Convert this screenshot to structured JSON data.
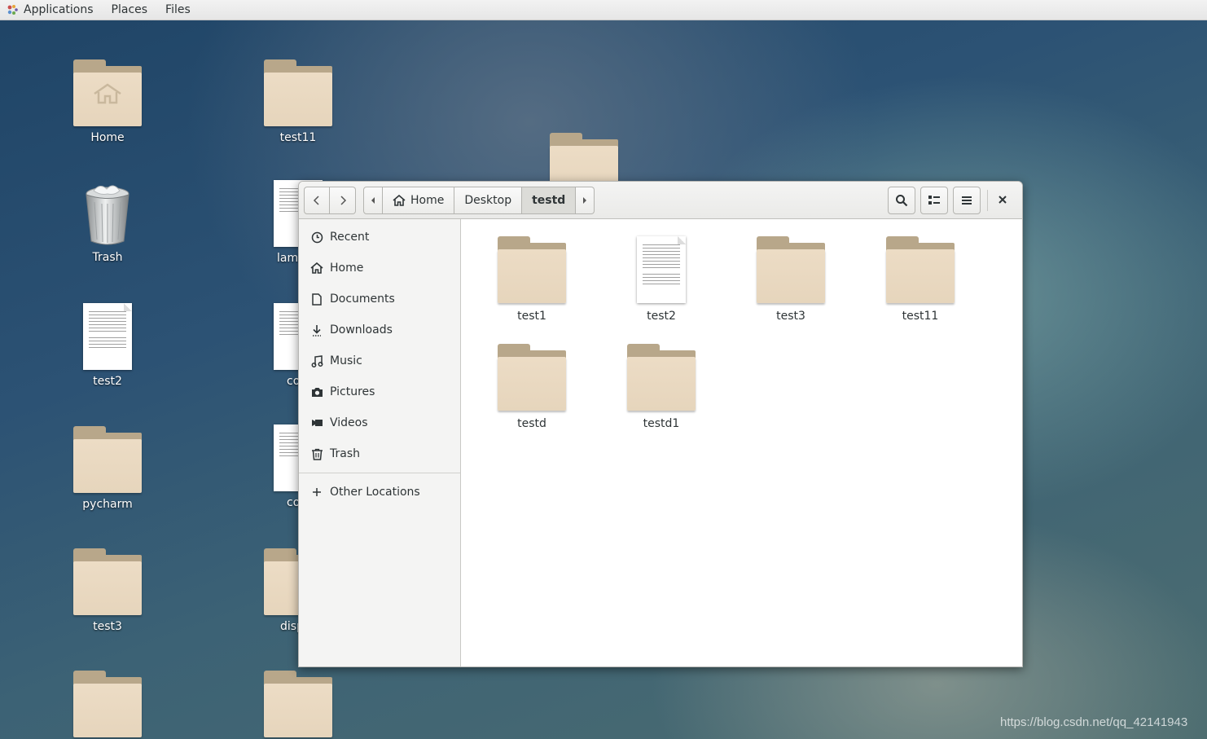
{
  "topbar": {
    "applications": "Applications",
    "places": "Places",
    "files": "Files"
  },
  "desktop": {
    "icons": [
      {
        "label": "Home",
        "type": "home-folder"
      },
      {
        "label": "test11",
        "type": "folder"
      },
      {
        "label": "Trash",
        "type": "trash"
      },
      {
        "label": "lamb",
        "type": "document"
      },
      {
        "label": "test2",
        "type": "document"
      },
      {
        "label": "co",
        "type": "document"
      },
      {
        "label": "pycharm",
        "type": "folder"
      },
      {
        "label": "co",
        "type": "document"
      },
      {
        "label": "test3",
        "type": "folder"
      },
      {
        "label": "disp",
        "type": "folder"
      },
      {
        "label": "",
        "type": "folder"
      },
      {
        "label": "",
        "type": "folder"
      },
      {
        "label": "",
        "type": "folder"
      }
    ]
  },
  "window": {
    "pathbar": {
      "segments": [
        "Home",
        "Desktop",
        "testd"
      ],
      "current": "testd"
    },
    "sidebar": {
      "items": [
        {
          "label": "Recent",
          "icon": "clock-icon"
        },
        {
          "label": "Home",
          "icon": "home-icon"
        },
        {
          "label": "Documents",
          "icon": "document-icon"
        },
        {
          "label": "Downloads",
          "icon": "download-icon"
        },
        {
          "label": "Music",
          "icon": "music-icon"
        },
        {
          "label": "Pictures",
          "icon": "camera-icon"
        },
        {
          "label": "Videos",
          "icon": "video-icon"
        },
        {
          "label": "Trash",
          "icon": "trash-icon"
        }
      ],
      "other": {
        "label": "Other Locations",
        "icon": "plus-icon"
      }
    },
    "files": [
      {
        "name": "test1",
        "type": "folder"
      },
      {
        "name": "test2",
        "type": "document"
      },
      {
        "name": "test3",
        "type": "folder"
      },
      {
        "name": "test11",
        "type": "folder"
      },
      {
        "name": "testd",
        "type": "folder"
      },
      {
        "name": "testd1",
        "type": "folder"
      }
    ]
  },
  "watermark": "https://blog.csdn.net/qq_42141943",
  "colors": {
    "folder": "#e9d9c1",
    "folder_tab": "#b8a78a",
    "topbar": "#ececec"
  }
}
